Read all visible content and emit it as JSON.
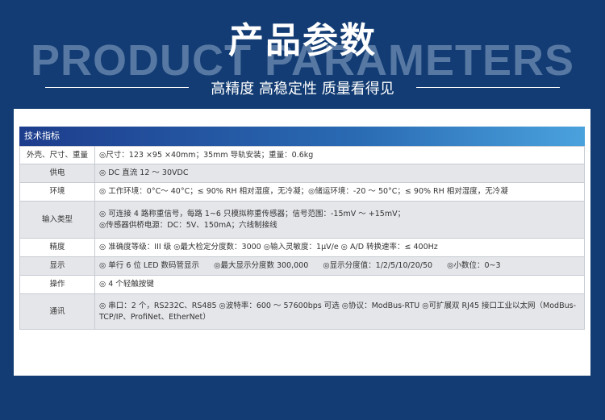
{
  "header": {
    "bg_text": "PRODUCT PARAMETERS",
    "title": "产品参数",
    "subtitle": "高精度 高稳定性 质量看得见"
  },
  "spec": {
    "heading": "技术指标",
    "rows": [
      {
        "label": "外壳、尺寸、重量",
        "value": "◎尺寸：123 ×95 ×40mm；35mm 导轨安装；重量：0.6kg"
      },
      {
        "label": "供电",
        "value": "◎ DC 直流 12 ～ 30VDC"
      },
      {
        "label": "环境",
        "value": "◎ 工作环境：0°C～ 40°C；≤ 90% RH 相对湿度，无冷凝；◎储运环境：-20 ～ 50°C；≤ 90% RH 相对湿度，无冷凝"
      },
      {
        "label": "输入类型",
        "value": "◎ 可连接 4 路称重信号，每路 1~6 只模拟称重传感器；信号范围：-15mV ～ +15mV；\n◎传感器供桥电源：DC：5V、150mA；六线制接线"
      },
      {
        "label": "精度",
        "value": "◎ 准确度等级：III 级 ◎最大检定分度数：3000 ◎输入灵敏度：1μV/e ◎ A/D 转换速率：≤ 400Hz"
      },
      {
        "label": "显示",
        "value": "◎ 单行 6 位 LED 数码管显示      ◎最大显示分度数 300,000      ◎显示分度值：1/2/5/10/20/50      ◎小数位：0~3"
      },
      {
        "label": "操作",
        "value": "◎ 4 个轻触按键"
      },
      {
        "label": "通讯",
        "value": "◎ 串口：2 个，RS232C、RS485   ◎波特率：600 ～ 57600bps 可选   ◎协议：ModBus-RTU   ◎可扩展双 RJ45 接口工业以太网（ModBus-TCP/IP、ProfiNet、EtherNet）"
      }
    ]
  }
}
